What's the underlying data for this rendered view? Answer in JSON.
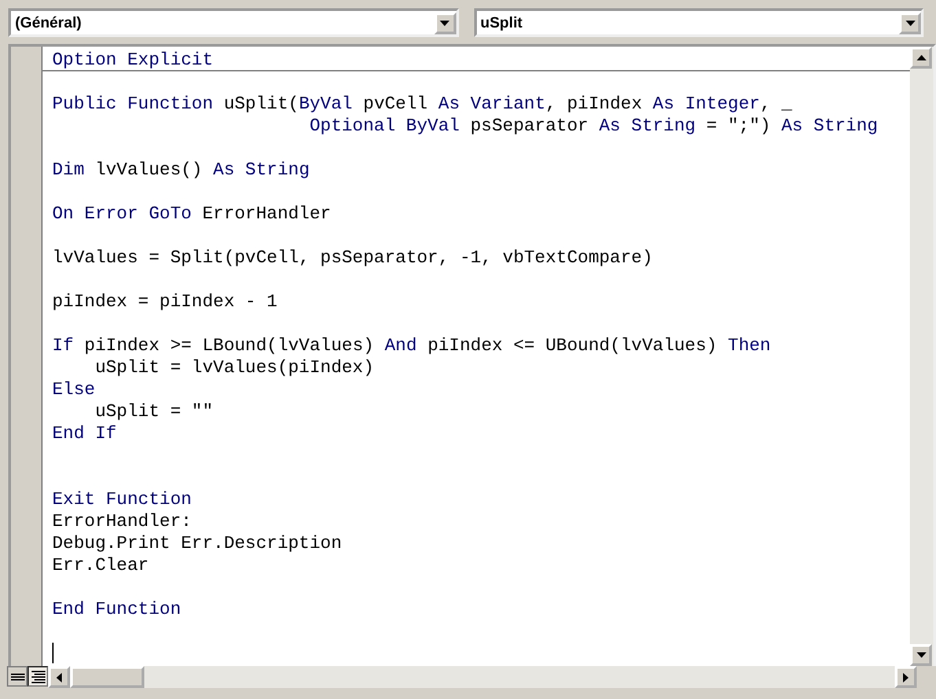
{
  "object_dropdown": {
    "value": "(Général)"
  },
  "procedure_dropdown": {
    "value": "uSplit"
  },
  "declarations": {
    "lines": [
      {
        "tokens": [
          {
            "kind": "keyword",
            "text": "Option Explicit"
          }
        ]
      }
    ]
  },
  "procedure": {
    "blocks": [
      {
        "lines": [
          {
            "tokens": [
              {
                "kind": "keyword",
                "text": "Public Function"
              },
              {
                "kind": "plain",
                "text": " uSplit("
              },
              {
                "kind": "keyword",
                "text": "ByVal"
              },
              {
                "kind": "plain",
                "text": " pvCell "
              },
              {
                "kind": "keyword",
                "text": "As Variant"
              },
              {
                "kind": "plain",
                "text": ", piIndex "
              },
              {
                "kind": "keyword",
                "text": "As Integer"
              },
              {
                "kind": "plain",
                "text": ", _"
              }
            ]
          },
          {
            "continuation": true,
            "tokens": [
              {
                "kind": "keyword",
                "text": "Optional ByVal"
              },
              {
                "kind": "plain",
                "text": " psSeparator "
              },
              {
                "kind": "keyword",
                "text": "As String"
              },
              {
                "kind": "plain",
                "text": " = \";\") "
              },
              {
                "kind": "keyword",
                "text": "As String"
              }
            ]
          }
        ]
      },
      {
        "lines": [
          {
            "tokens": [
              {
                "kind": "keyword",
                "text": "Dim"
              },
              {
                "kind": "plain",
                "text": " lvValues() "
              },
              {
                "kind": "keyword",
                "text": "As String"
              }
            ]
          }
        ]
      },
      {
        "lines": [
          {
            "tokens": [
              {
                "kind": "keyword",
                "text": "On Error GoTo"
              },
              {
                "kind": "plain",
                "text": " ErrorHandler"
              }
            ]
          }
        ]
      },
      {
        "lines": [
          {
            "tokens": [
              {
                "kind": "plain",
                "text": "lvValues = Split(pvCell, psSeparator, -1, vbTextCompare)"
              }
            ]
          }
        ]
      },
      {
        "lines": [
          {
            "tokens": [
              {
                "kind": "plain",
                "text": "piIndex = piIndex - 1"
              }
            ]
          }
        ]
      },
      {
        "lines": [
          {
            "tokens": [
              {
                "kind": "keyword",
                "text": "If"
              },
              {
                "kind": "plain",
                "text": " piIndex >= LBound(lvValues) "
              },
              {
                "kind": "keyword",
                "text": "And"
              },
              {
                "kind": "plain",
                "text": " piIndex <= UBound(lvValues) "
              },
              {
                "kind": "keyword",
                "text": "Then"
              }
            ]
          },
          {
            "tokens": [
              {
                "kind": "plain",
                "text": "    uSplit = lvValues(piIndex)"
              }
            ]
          },
          {
            "tokens": [
              {
                "kind": "keyword",
                "text": "Else"
              }
            ]
          },
          {
            "tokens": [
              {
                "kind": "plain",
                "text": "    uSplit = \"\""
              }
            ]
          },
          {
            "tokens": [
              {
                "kind": "keyword",
                "text": "End If"
              }
            ]
          }
        ]
      },
      {
        "extra_blank_line_before": true,
        "lines": [
          {
            "tokens": [
              {
                "kind": "keyword",
                "text": "Exit Function"
              }
            ]
          },
          {
            "tokens": [
              {
                "kind": "plain",
                "text": "ErrorHandler:"
              }
            ]
          },
          {
            "tokens": [
              {
                "kind": "plain",
                "text": "Debug.Print Err.Description"
              }
            ]
          },
          {
            "tokens": [
              {
                "kind": "plain",
                "text": "Err.Clear"
              }
            ]
          }
        ]
      },
      {
        "lines": [
          {
            "tokens": [
              {
                "kind": "keyword",
                "text": "End Function"
              }
            ]
          }
        ]
      },
      {
        "lines": [
          {
            "cursor": true
          }
        ]
      }
    ]
  }
}
